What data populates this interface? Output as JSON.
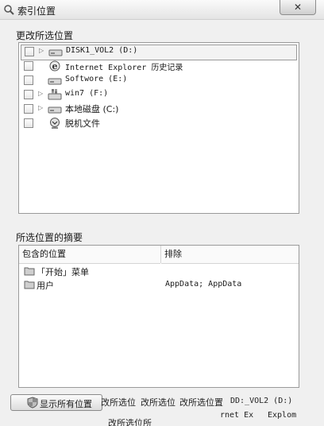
{
  "window": {
    "title": "索引位置",
    "close_icon": "close-icon"
  },
  "locations": {
    "label": "更改所选位置",
    "items": [
      {
        "label": "DISK1_VOL2 (D:)",
        "icon": "drive-icon",
        "has_expander": true,
        "selected": true
      },
      {
        "label": "Internet Explorer 历史记录",
        "icon": "internet-explorer-icon",
        "has_expander": false
      },
      {
        "label": "Softwore (E:)",
        "icon": "drive-icon",
        "has_expander": false
      },
      {
        "label": "win7 (F:)",
        "icon": "system-drive-icon",
        "has_expander": true
      },
      {
        "label": "本地磁盘 (C:)",
        "icon": "drive-icon",
        "has_expander": true
      },
      {
        "label": "脱机文件",
        "icon": "offline-files-icon",
        "has_expander": false
      }
    ]
  },
  "summary": {
    "label": "所选位置的摘要",
    "columns": [
      "包含的位置",
      "排除"
    ],
    "rows": [
      {
        "included": "「开始」菜单",
        "excluded": ""
      },
      {
        "included": "用户",
        "excluded": "AppData; AppData"
      }
    ]
  },
  "show_all_button": {
    "label": "显示所有位置"
  },
  "ghost_text": {
    "line1_a": "改所选位",
    "line1_b": "改所选位",
    "line1_c": "改所选位置",
    "line1_d": "DD:_VOL2 (D:)",
    "line2_a": "rnet Ex",
    "line2_b": "Explom",
    "line3": "改所选位所"
  }
}
